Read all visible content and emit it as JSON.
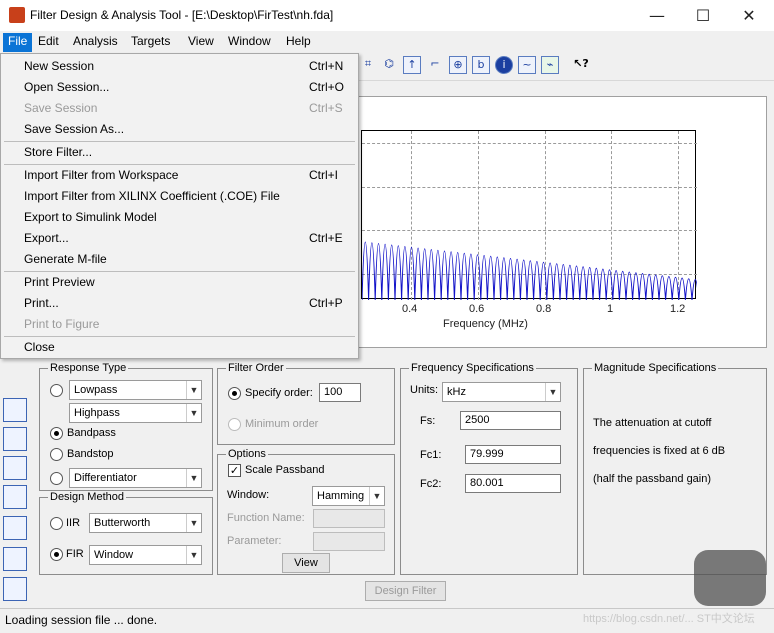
{
  "window": {
    "title": "Filter Design & Analysis Tool -  [E:\\Desktop\\FirTest\\nh.fda]",
    "minimize": "—",
    "maximize": "☐",
    "close": "✕"
  },
  "menubar": [
    "File",
    "Edit",
    "Analysis",
    "Targets",
    "View",
    "Window",
    "Help"
  ],
  "file_menu": {
    "items": [
      {
        "label": "New Session",
        "shortcut": "Ctrl+N",
        "enabled": true
      },
      {
        "label": "Open Session...",
        "shortcut": "Ctrl+O",
        "enabled": true
      },
      {
        "label": "Save Session",
        "shortcut": "Ctrl+S",
        "enabled": false
      },
      {
        "label": "Save Session As...",
        "shortcut": "",
        "enabled": true
      },
      {
        "label": "Store Filter...",
        "shortcut": "",
        "enabled": true
      },
      {
        "label": "Import Filter from Workspace",
        "shortcut": "Ctrl+I",
        "enabled": true
      },
      {
        "label": "Import Filter from XILINX Coefficient (.COE) File",
        "shortcut": "",
        "enabled": true
      },
      {
        "label": "Export to Simulink Model",
        "shortcut": "",
        "enabled": true
      },
      {
        "label": "Export...",
        "shortcut": "Ctrl+E",
        "enabled": true
      },
      {
        "label": "Generate M-file",
        "shortcut": "",
        "enabled": true
      },
      {
        "label": "Print Preview",
        "shortcut": "",
        "enabled": true
      },
      {
        "label": "Print...",
        "shortcut": "Ctrl+P",
        "enabled": true
      },
      {
        "label": "Print to Figure",
        "shortcut": "",
        "enabled": false
      },
      {
        "label": "Close",
        "shortcut": "",
        "enabled": true
      }
    ]
  },
  "plot": {
    "xlabel": "Frequency (MHz)",
    "xticks": [
      "0.4",
      "0.6",
      "0.8",
      "1",
      "1.2"
    ]
  },
  "response_type": {
    "title": "Response Type",
    "options": [
      {
        "label": "Lowpass",
        "selected": false
      },
      {
        "label": "Highpass",
        "selected": false
      },
      {
        "label": "Bandpass",
        "selected": true
      },
      {
        "label": "Bandstop",
        "selected": false
      },
      {
        "label": "Differentiator",
        "selected": false
      }
    ]
  },
  "design_method": {
    "title": "Design Method",
    "iir_label": "IIR",
    "iir_value": "Butterworth",
    "fir_label": "FIR",
    "fir_value": "Window",
    "selected": "FIR"
  },
  "filter_order": {
    "title": "Filter Order",
    "specify_label": "Specify order:",
    "specify_value": "100",
    "minimum_label": "Minimum order"
  },
  "options": {
    "title": "Options",
    "scale_passband": "Scale Passband",
    "scale_checked": true,
    "window_label": "Window:",
    "window_value": "Hamming",
    "function_name_label": "Function Name:",
    "parameter_label": "Parameter:",
    "view_button": "View"
  },
  "frequency_specs": {
    "title": "Frequency Specifications",
    "units_label": "Units:",
    "units_value": "kHz",
    "fs_label": "Fs:",
    "fs_value": "2500",
    "fc1_label": "Fc1:",
    "fc1_value": "79.999",
    "fc2_label": "Fc2:",
    "fc2_value": "80.001"
  },
  "magnitude_specs": {
    "title": "Magnitude Specifications",
    "line1": "The attenuation at cutoff",
    "line2": "frequencies is fixed at 6 dB",
    "line3": "(half the passband gain)"
  },
  "design_button": "Design Filter",
  "status": "Loading session file ... done.",
  "watermark": "https://blog.csdn.net/...  ST中文论坛",
  "colors": {
    "menu_highlight": "#0b74d6",
    "plot_line": "#1010c8"
  }
}
